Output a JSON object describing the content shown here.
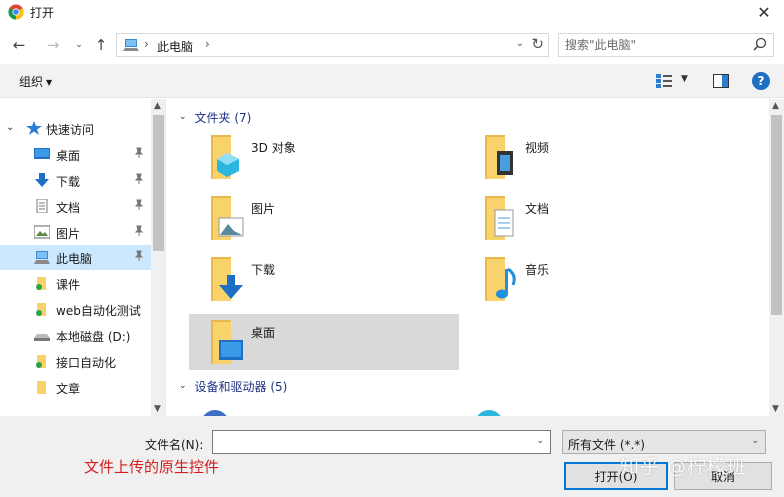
{
  "window": {
    "title": "打开",
    "close_glyph": "✕"
  },
  "address": {
    "crumb": "此电脑",
    "search_placeholder": "搜索\"此电脑\""
  },
  "toolbar": {
    "organize_label": "组织"
  },
  "sidebar": {
    "items": [
      {
        "label": "快速访问",
        "icon": "star-icon"
      },
      {
        "label": "桌面",
        "icon": "desktop-icon",
        "pinned": true
      },
      {
        "label": "下载",
        "icon": "download-icon",
        "pinned": true
      },
      {
        "label": "文档",
        "icon": "document-icon",
        "pinned": true
      },
      {
        "label": "图片",
        "icon": "picture-icon",
        "pinned": true
      },
      {
        "label": "此电脑",
        "icon": "computer-icon",
        "pinned": true,
        "selected": true
      },
      {
        "label": "课件",
        "icon": "folder-icon"
      },
      {
        "label": "web自动化测试",
        "icon": "folder-icon"
      },
      {
        "label": "本地磁盘 (D:)",
        "icon": "drive-icon"
      },
      {
        "label": "接口自动化",
        "icon": "folder-icon"
      },
      {
        "label": "文章",
        "icon": "folder-icon"
      }
    ]
  },
  "main": {
    "folders_header": "文件夹 (7)",
    "folders": [
      {
        "label": "3D 对象",
        "icon": "3d-objects-folder-icon"
      },
      {
        "label": "视频",
        "icon": "videos-folder-icon"
      },
      {
        "label": "图片",
        "icon": "pictures-folder-icon"
      },
      {
        "label": "文档",
        "icon": "documents-folder-icon"
      },
      {
        "label": "下载",
        "icon": "downloads-folder-icon"
      },
      {
        "label": "音乐",
        "icon": "music-folder-icon"
      },
      {
        "label": "桌面",
        "icon": "desktop-folder-icon",
        "selected": true
      }
    ],
    "devices_header": "设备和驱动器 (5)"
  },
  "bottom": {
    "filename_label": "文件名(N):",
    "filename_value": "",
    "filter_value": "所有文件 (*.*)",
    "open_label": "打开(O)",
    "cancel_label": "取消",
    "caption": "文件上传的原生控件",
    "watermark": "知乎 @柠檬班"
  },
  "colors": {
    "accent": "#0078d7",
    "selection": "#cce8ff",
    "group_header": "#1e3287",
    "caption_red": "#d21e1e",
    "folder_yellow": "#f8d26a"
  }
}
